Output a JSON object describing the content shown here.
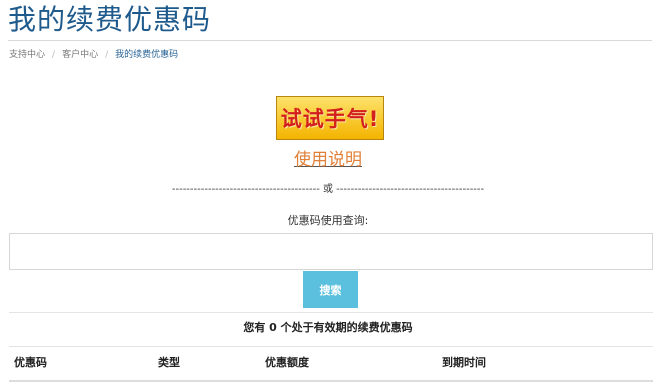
{
  "page": {
    "title": "我的续费优惠码"
  },
  "breadcrumb": {
    "items": [
      "支持中心",
      "客户中心"
    ],
    "active": "我的续费优惠码",
    "separator": "/"
  },
  "lucky": {
    "label": "试试手气!"
  },
  "usage": {
    "link_label": "使用说明"
  },
  "divider": {
    "text": "----------------------------------------- 或 -----------------------------------------"
  },
  "query": {
    "label": "优惠码使用查询:",
    "input_value": "",
    "search_label": "搜索"
  },
  "summary": {
    "text": "您有 0 个处于有效期的续费优惠码"
  },
  "table": {
    "columns": [
      "优惠码",
      "类型",
      "优惠额度",
      "到期时间"
    ]
  },
  "colors": {
    "title": "#1e5a8c",
    "search_button": "#5bc0de",
    "lucky_text": "#d41d1d",
    "lucky_bg": "#f4b400",
    "usage_link": "#e0803a"
  }
}
